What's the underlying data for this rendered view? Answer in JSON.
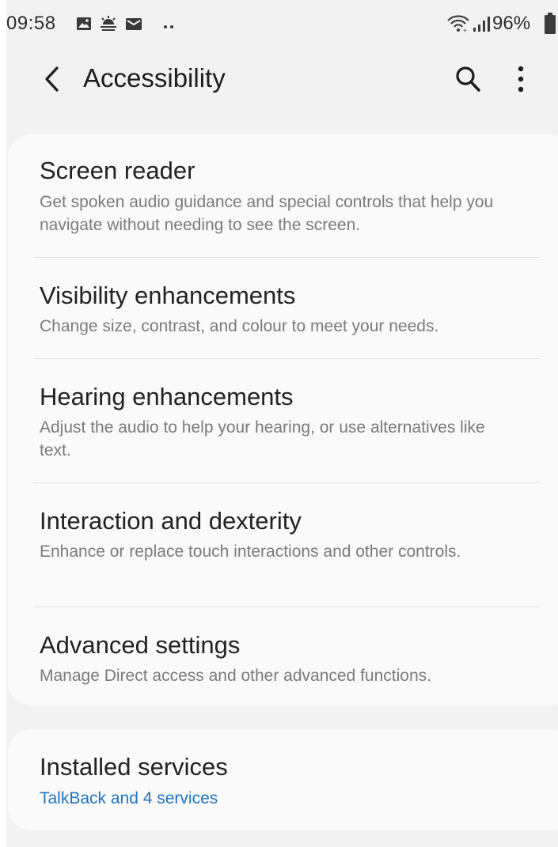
{
  "status_bar": {
    "time": "09:58",
    "battery": "96%",
    "left_icons": [
      "image-icon",
      "weather-icon",
      "mail-icon",
      "more-notifications-icon"
    ],
    "right_icons": [
      "wifi-icon",
      "signal-icon",
      "battery-icon"
    ]
  },
  "app_bar": {
    "title": "Accessibility",
    "back_icon": "chevron-left-icon",
    "search_icon": "search-icon",
    "more_icon": "more-vert-icon"
  },
  "settings": [
    {
      "title": "Screen reader",
      "description": "Get spoken audio guidance and special controls that help you navigate without needing to see the screen."
    },
    {
      "title": "Visibility enhancements",
      "description": "Change size, contrast, and colour to meet your needs."
    },
    {
      "title": "Hearing enhancements",
      "description": "Adjust the audio to help your hearing, or use alternatives like text."
    },
    {
      "title": "Interaction and dexterity",
      "description": "Enhance or replace touch interactions and other controls."
    },
    {
      "title": "Advanced settings",
      "description": "Manage Direct access and other advanced functions."
    }
  ],
  "installed_services": {
    "title": "Installed services",
    "summary": "TalkBack and 4 services"
  },
  "colors": {
    "background": "#f2f2f2",
    "card": "#fafafa",
    "title_text": "#222222",
    "secondary_text": "#7a7a7a",
    "accent": "#1f75c4"
  }
}
